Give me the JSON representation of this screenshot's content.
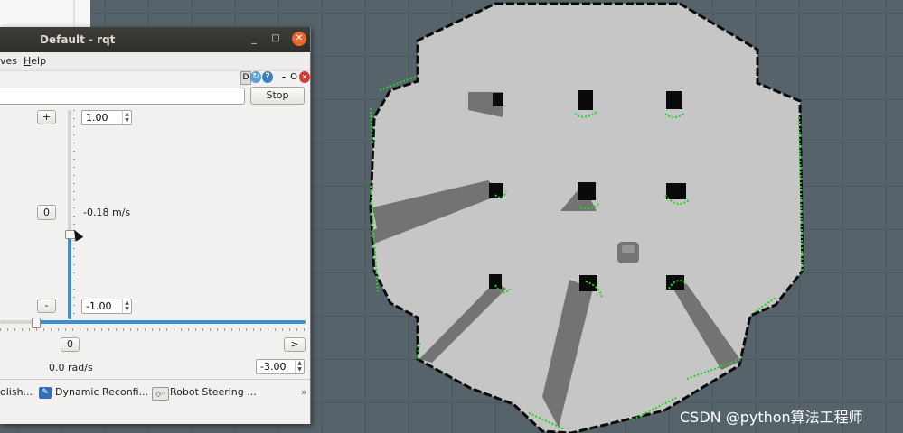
{
  "watermark": "CSDN @python算法工程师",
  "window": {
    "title": "Default - rqt",
    "controls": [
      "_",
      "□",
      "✕"
    ]
  },
  "menubar": {
    "items": [
      {
        "label": "ves"
      },
      {
        "label": "Help",
        "mnemonic": "H",
        "rest": "elp"
      }
    ]
  },
  "plugin_controls": {
    "d": "D",
    "reload": "↻",
    "help": "?",
    "minimize": "-",
    "undock": "O",
    "close": "✕"
  },
  "topic_input": {
    "value": ""
  },
  "stop_button": {
    "label": "Stop"
  },
  "linear": {
    "plus_label": "+",
    "zero_label": "0",
    "minus_label": "-",
    "max_value": "1.00",
    "min_value": "-1.00",
    "current": "-0.18 m/s",
    "slider_level": -0.18,
    "slider_range": [
      -1.0,
      1.0
    ]
  },
  "angular": {
    "zero_label": "0",
    "right_label": ">",
    "current": "0.0 rad/s",
    "min_value": "-3.00",
    "slider_level": 0.0,
    "slider_range": [
      -3.0,
      3.0
    ]
  },
  "tabs": [
    {
      "label": "olish...",
      "icon": "none"
    },
    {
      "label": "Dynamic Reconfi...",
      "icon": "pencil-icon"
    },
    {
      "label": "Robot Steering ...",
      "icon": "gamepad-icon"
    }
  ],
  "tabs_overflow": "»",
  "colors": {
    "background": "#56636a",
    "grid_line": "#4b575e",
    "free_space": "#c6c6c6",
    "unknown_shadow": "#737373",
    "obstacle": "#0a0a0a",
    "laser_scan": "#1ed51e",
    "slider_fill": "#3c8fd0",
    "close_button": "#e9672f"
  }
}
